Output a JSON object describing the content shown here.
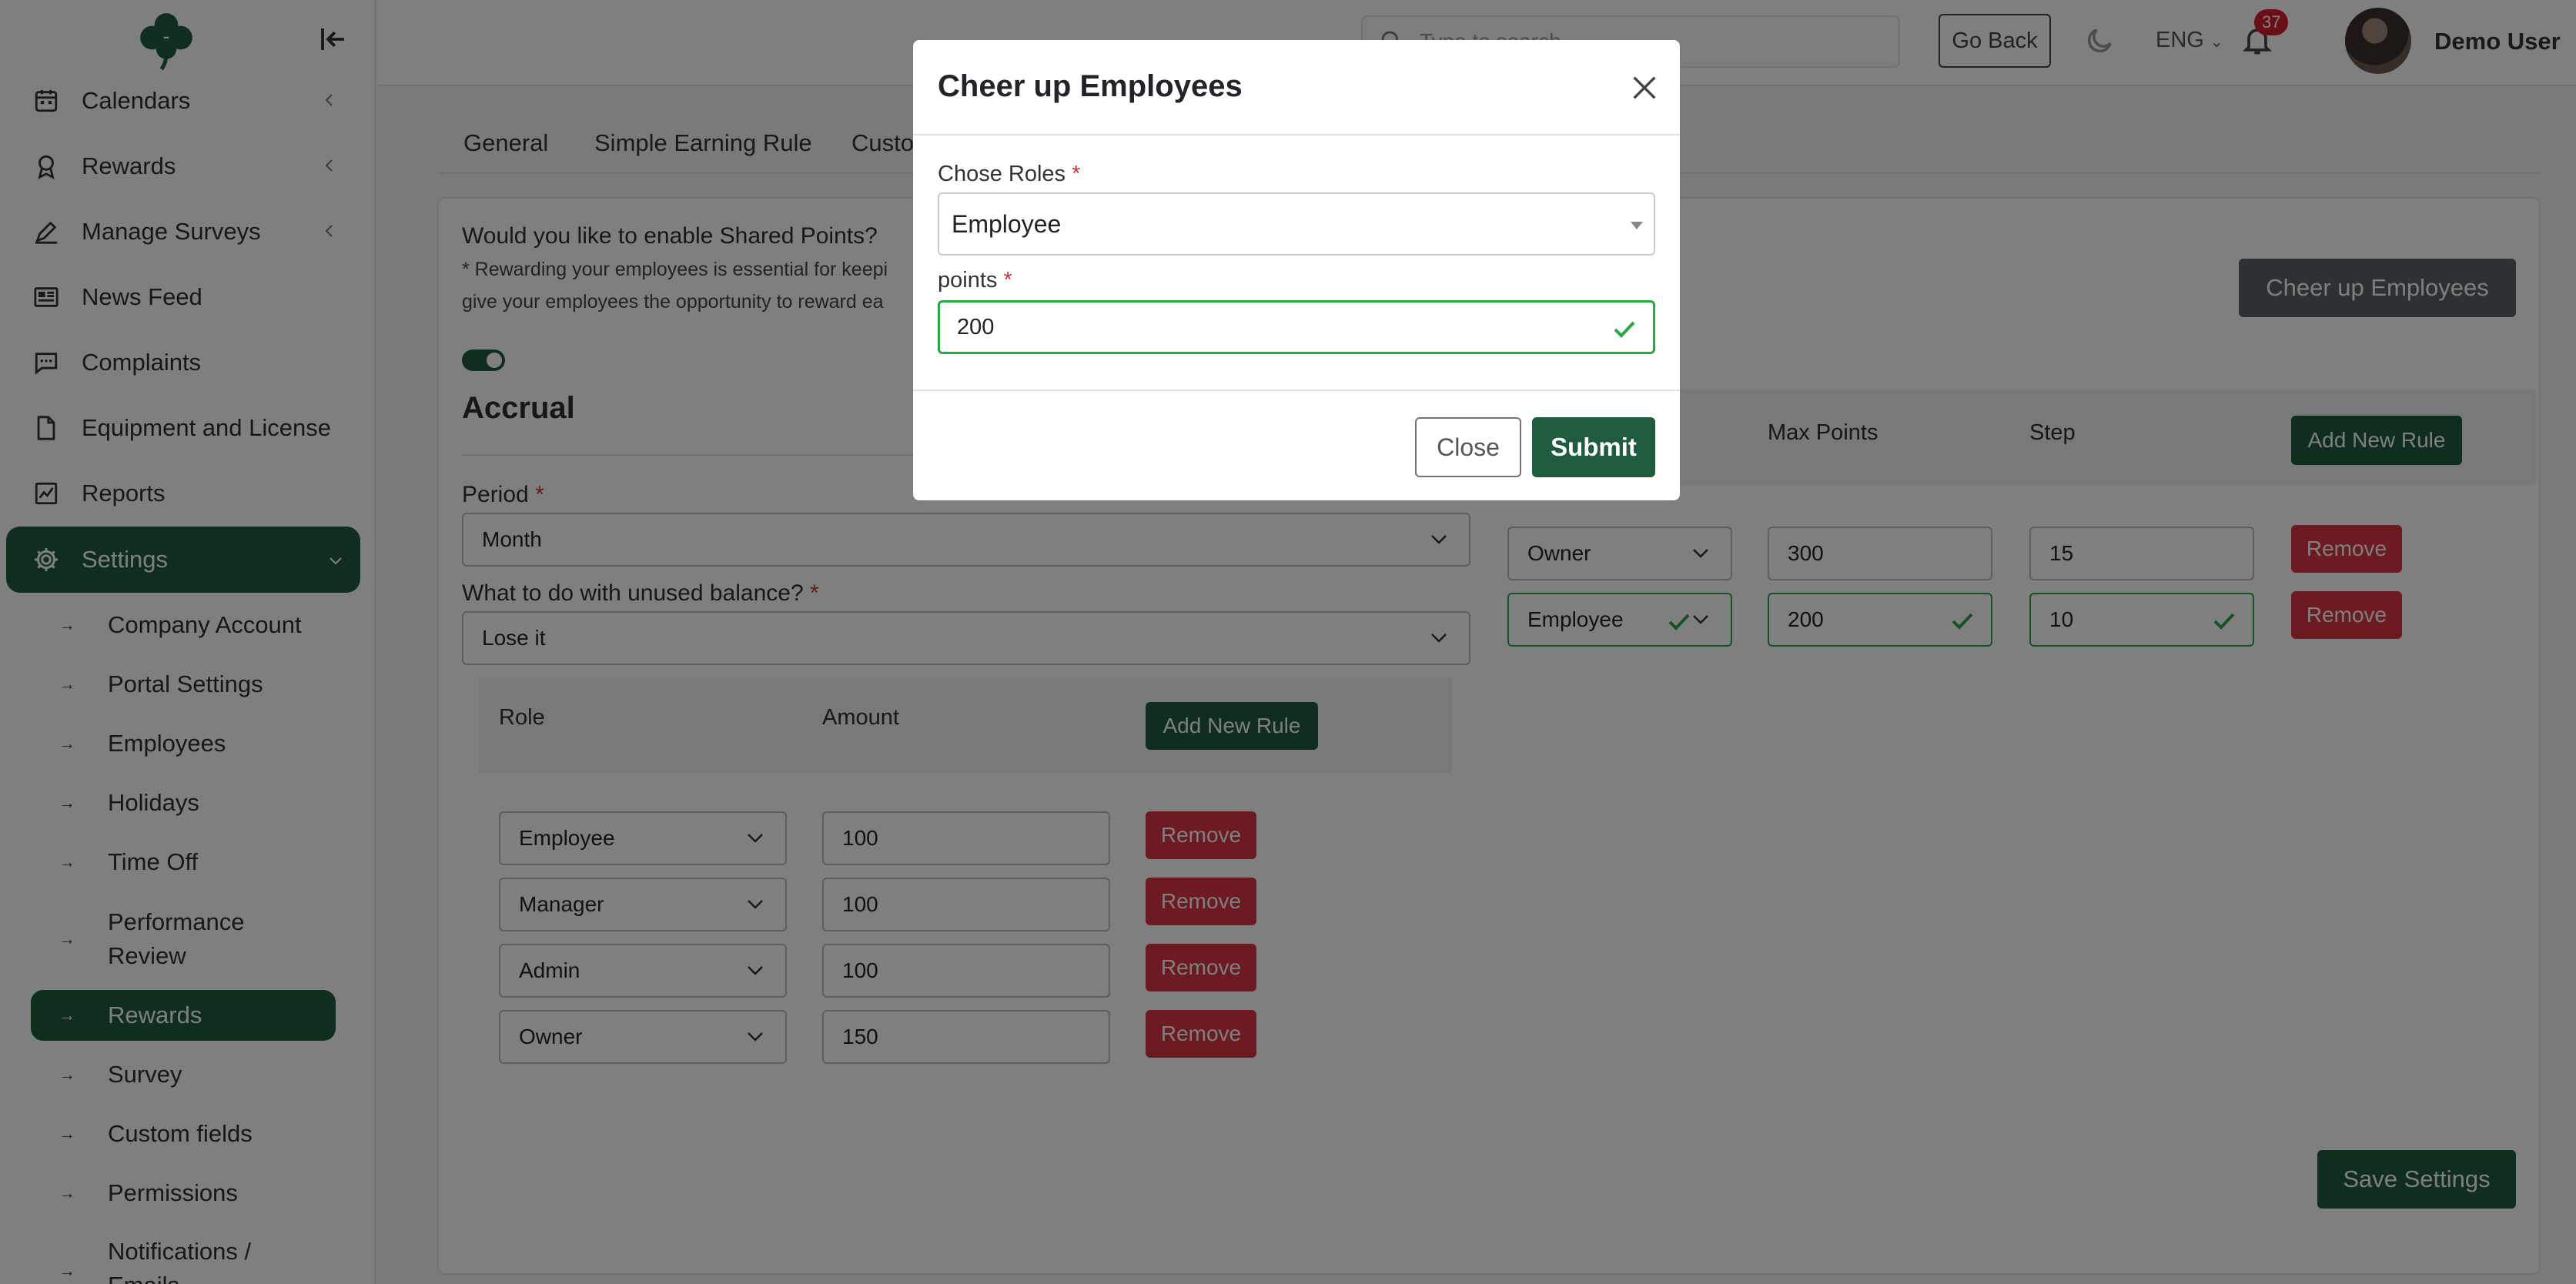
{
  "sidebar": {
    "items": [
      {
        "label": "Calendars",
        "icon": "calendar-icon",
        "expandable": true
      },
      {
        "label": "Rewards",
        "icon": "award-icon",
        "expandable": true
      },
      {
        "label": "Manage Surveys",
        "icon": "survey-pen-icon",
        "expandable": true
      },
      {
        "label": "News Feed",
        "icon": "newspaper-icon",
        "expandable": false
      },
      {
        "label": "Complaints",
        "icon": "chat-icon",
        "expandable": false
      },
      {
        "label": "Equipment and License",
        "icon": "document-icon",
        "expandable": false
      },
      {
        "label": "Reports",
        "icon": "chart-icon",
        "expandable": false
      },
      {
        "label": "Settings",
        "icon": "gear-icon",
        "expandable": true,
        "active": true
      }
    ],
    "sub_items": [
      {
        "label": "Company Account"
      },
      {
        "label": "Portal Settings"
      },
      {
        "label": "Employees"
      },
      {
        "label": "Holidays"
      },
      {
        "label": "Time Off"
      },
      {
        "label": "Performance Review"
      },
      {
        "label": "Rewards",
        "active": true
      },
      {
        "label": "Survey"
      },
      {
        "label": "Custom fields"
      },
      {
        "label": "Permissions"
      },
      {
        "label": "Notifications / Emails"
      }
    ]
  },
  "topbar": {
    "search_placeholder": "Type to search",
    "go_back": "Go Back",
    "language": "ENG",
    "notification_count": "37",
    "user_name": "Demo User"
  },
  "tabs": [
    "General",
    "Simple Earning Rule",
    "Custo"
  ],
  "settings": {
    "shared_points_question": "Would you like to enable Shared Points?",
    "shared_points_note_1": "* Rewarding your employees is essential for keepi",
    "shared_points_note_2": "give your employees the opportunity to reward ea",
    "accrual_title": "Accrual",
    "period_label": "Period",
    "period_value": "Month",
    "unused_label": "What to do with unused balance?",
    "unused_value": "Lose it",
    "rules_headers": {
      "role": "Role",
      "amount": "Amount"
    },
    "add_rule": "Add New Rule",
    "remove": "Remove",
    "rules": [
      {
        "role": "Employee",
        "amount": "100"
      },
      {
        "role": "Manager",
        "amount": "100"
      },
      {
        "role": "Admin",
        "amount": "100"
      },
      {
        "role": "Owner",
        "amount": "150"
      }
    ],
    "cheer_button": "Cheer up Employees",
    "right_headers": {
      "max_points": "Max Points",
      "step": "Step"
    },
    "right_rules": [
      {
        "role": "Owner",
        "max": "300",
        "step": "15",
        "valid": false
      },
      {
        "role": "Employee",
        "max": "200",
        "step": "10",
        "valid": true
      }
    ],
    "save": "Save Settings"
  },
  "modal": {
    "title": "Cheer up Employees",
    "roles_label": "Chose Roles",
    "roles_value": "Employee",
    "points_label": "points",
    "points_value": "200",
    "close": "Close",
    "submit": "Submit"
  },
  "colors": {
    "primary": "#1f5c3d",
    "danger": "#dc3545",
    "valid": "#28a745"
  }
}
